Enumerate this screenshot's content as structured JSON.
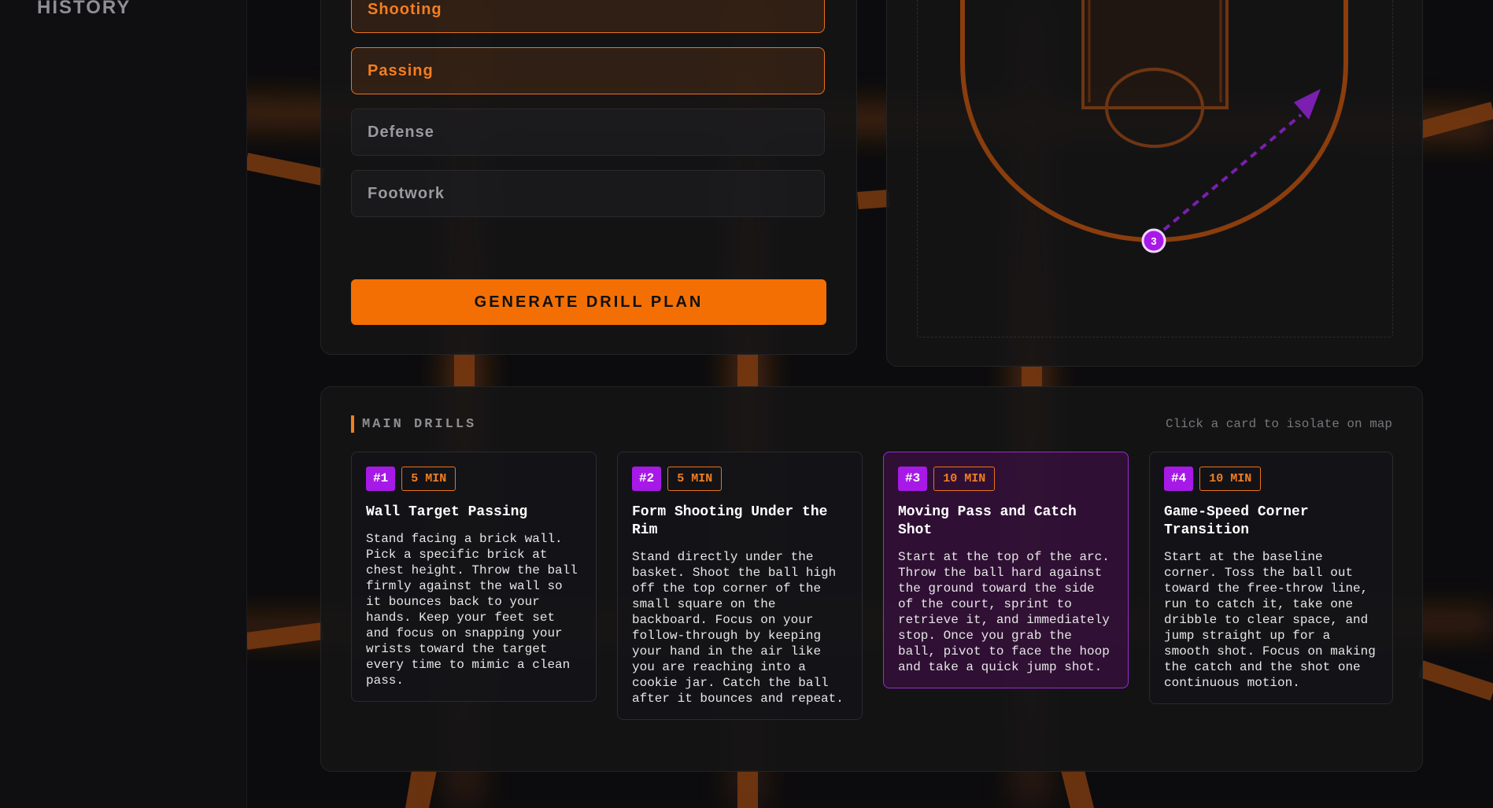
{
  "sidebar": {
    "title": "HISTORY"
  },
  "focus": {
    "options": [
      {
        "label": "Shooting",
        "active": true
      },
      {
        "label": "Passing",
        "active": true
      },
      {
        "label": "Defense",
        "active": false
      },
      {
        "label": "Footwork",
        "active": false
      }
    ],
    "generate_label": "GENERATE DRILL PLAN"
  },
  "map": {
    "marker_label": "3"
  },
  "drills": {
    "heading": "MAIN DRILLS",
    "hint": "Click a card to isolate on map",
    "cards": [
      {
        "number": "#1",
        "duration": "5 MIN",
        "title": "Wall Target Passing",
        "selected": false,
        "description": "Stand facing a brick wall. Pick a specific brick at chest height. Throw the ball firmly against the wall so it bounces back to your hands. Keep your feet set and focus on snapping your wrists toward the target every time to mimic a clean pass."
      },
      {
        "number": "#2",
        "duration": "5 MIN",
        "title": "Form Shooting Under the Rim",
        "selected": false,
        "description": "Stand directly under the basket. Shoot the ball high off the top corner of the small square on the backboard. Focus on your follow-through by keeping your hand in the air like you are reaching into a cookie jar. Catch the ball after it bounces and repeat."
      },
      {
        "number": "#3",
        "duration": "10 MIN",
        "title": "Moving Pass and Catch Shot",
        "selected": true,
        "description": "Start at the top of the arc. Throw the ball hard against the ground toward the side of the court, sprint to retrieve it, and immediately stop. Once you grab the ball, pivot to face the hoop and take a quick jump shot."
      },
      {
        "number": "#4",
        "duration": "10 MIN",
        "title": "Game-Speed Corner Transition",
        "selected": false,
        "description": "Start at the baseline corner. Toss the ball out toward the free-throw line, run to catch it, take one dribble to clear space, and jump straight up for a smooth shot. Focus on making the catch and the shot one continuous motion."
      }
    ]
  },
  "colors": {
    "accent": "#f46f03",
    "purple": "#a719e6"
  }
}
